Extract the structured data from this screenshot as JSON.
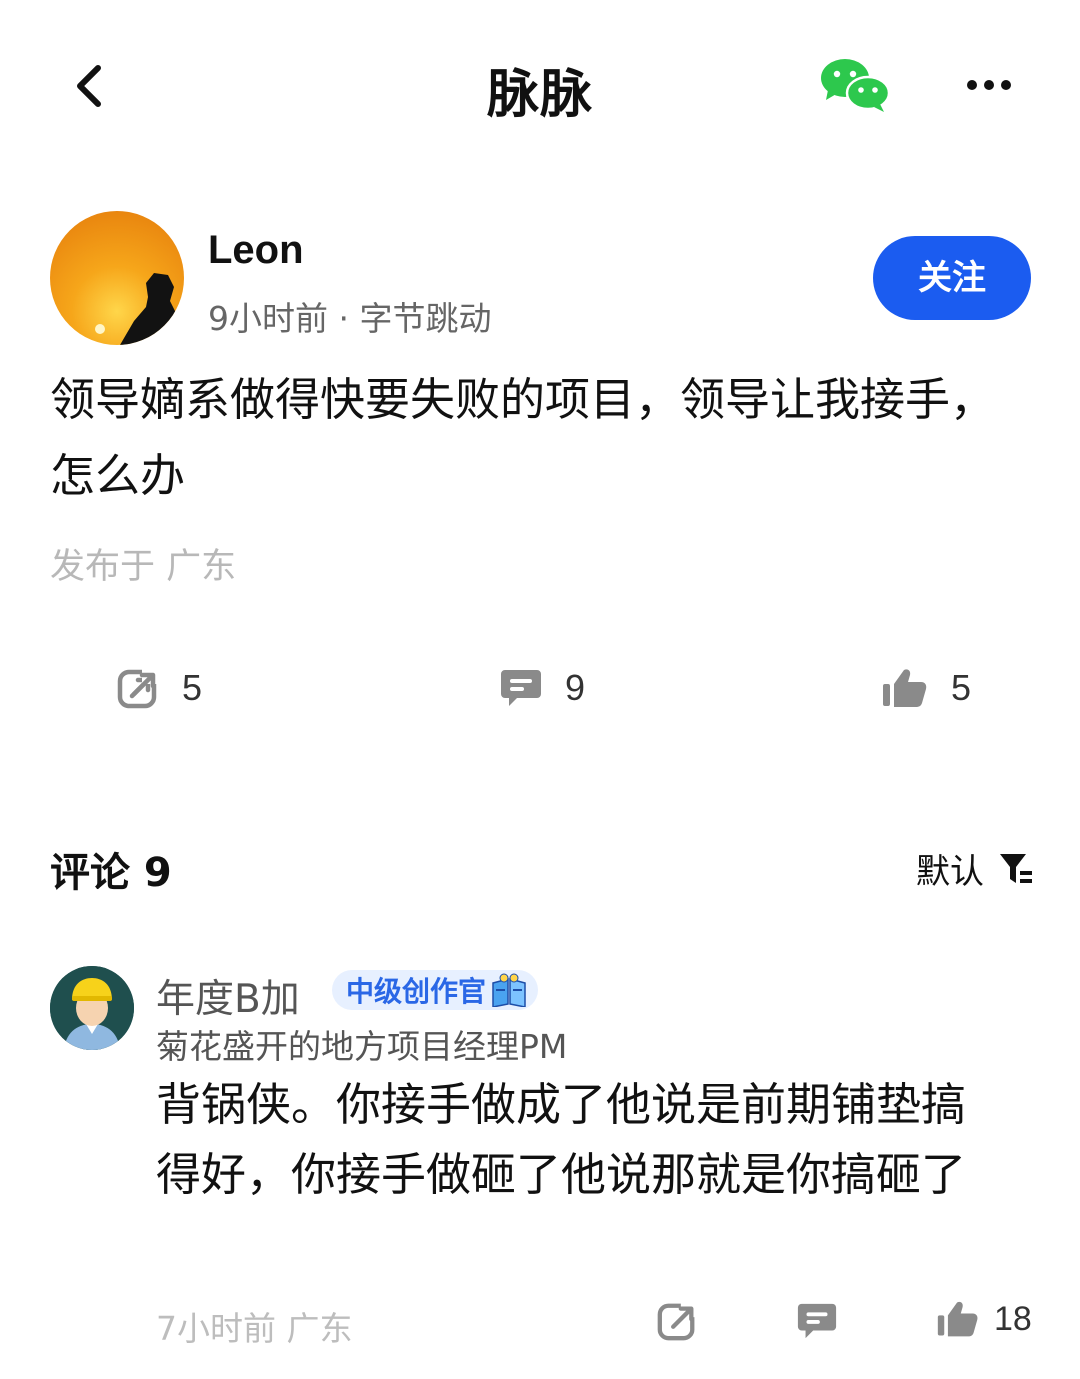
{
  "header": {
    "title": "脉脉",
    "back_icon": "chevron-left-icon",
    "share_icon": "wechat-icon",
    "more_icon": "more-horizontal-icon"
  },
  "post": {
    "author": {
      "name": "Leon",
      "meta": "9小时前 · 字节跳动"
    },
    "follow_label": "关注",
    "content": "领导嫡系做得快要失败的项目，领导让我接手，怎么办",
    "location": "发布于 广东",
    "stats": {
      "share": "5",
      "comments": "9",
      "likes": "5"
    }
  },
  "comments": {
    "title": "评论 9",
    "sort_label": "默认",
    "items": [
      {
        "name": "年度B加",
        "badge": "中级创作官",
        "subtitle": "菊花盛开的地方项目经理PM",
        "content": "背锅侠。你接手做成了他说是前期铺垫搞得好，你接手做砸了他说那就是你搞砸了",
        "meta": "7小时前  广东",
        "likes": "18"
      }
    ]
  },
  "colors": {
    "accent": "#1b5cf0",
    "wechat_green": "#2dc84d",
    "badge_bg": "#e7f0ff",
    "badge_text": "#2a67e6"
  }
}
